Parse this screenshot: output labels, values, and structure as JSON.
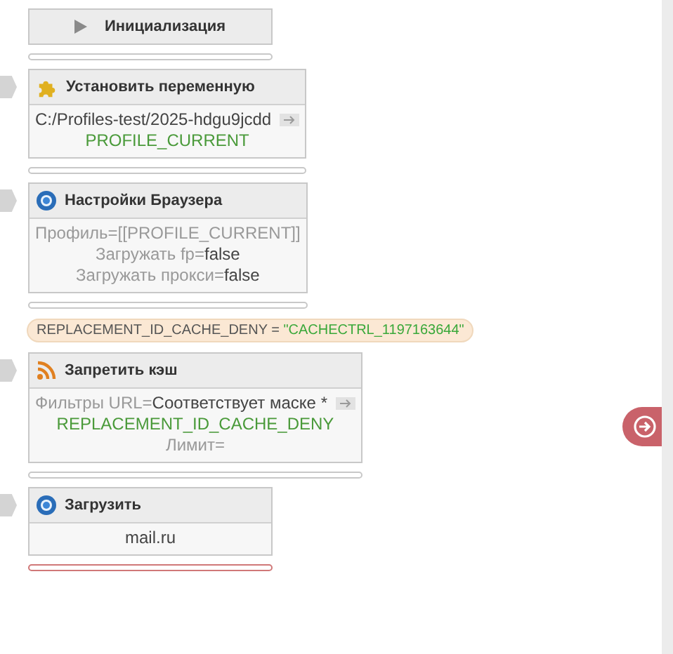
{
  "blocks": [
    {
      "title": "Инициализация",
      "kind": "start",
      "tab": false,
      "bar_failed": false
    },
    {
      "title": "Установить переменную",
      "kind": "variable",
      "tab": true,
      "lines": [
        [
          {
            "text": "C:/Profiles-test/2025-hdgu9jcdd",
            "kind": "value",
            "arrow": true
          }
        ],
        [
          {
            "text": "PROFILE_CURRENT",
            "kind": "variable"
          }
        ]
      ],
      "bar_failed": false
    },
    {
      "title": "Настройки Браузера",
      "kind": "browser",
      "tab": true,
      "lines": [
        [
          {
            "text": "Профиль=[[PROFILE_CURRENT]]",
            "kind": "label"
          }
        ],
        [
          {
            "text": "Загружать fp=",
            "kind": "label"
          },
          {
            "text": "false",
            "kind": "value"
          }
        ],
        [
          {
            "text": "Загружать прокси=",
            "kind": "label"
          },
          {
            "text": "false",
            "kind": "value"
          }
        ]
      ],
      "bar_failed": false,
      "after": {
        "name": "REPLACEMENT_ID_CACHE_DENY = ",
        "value": "\"CACHECTRL_1197163644\""
      }
    },
    {
      "title": "Запретить кэш",
      "kind": "feed",
      "tab": true,
      "lines": [
        [
          {
            "text": "Фильтры URL=",
            "kind": "label"
          },
          {
            "text": "Соответствует маске *",
            "kind": "value",
            "arrow": true
          }
        ],
        [
          {
            "text": "REPLACEMENT_ID_CACHE_DENY",
            "kind": "variable"
          }
        ],
        [
          {
            "text": "Лимит=",
            "kind": "label"
          }
        ]
      ],
      "bar_failed": false
    },
    {
      "title": "Загрузить",
      "kind": "browser",
      "tab": true,
      "lines": [
        [
          {
            "text": "mail.ru",
            "kind": "value"
          }
        ]
      ],
      "bar_failed": true
    }
  ]
}
